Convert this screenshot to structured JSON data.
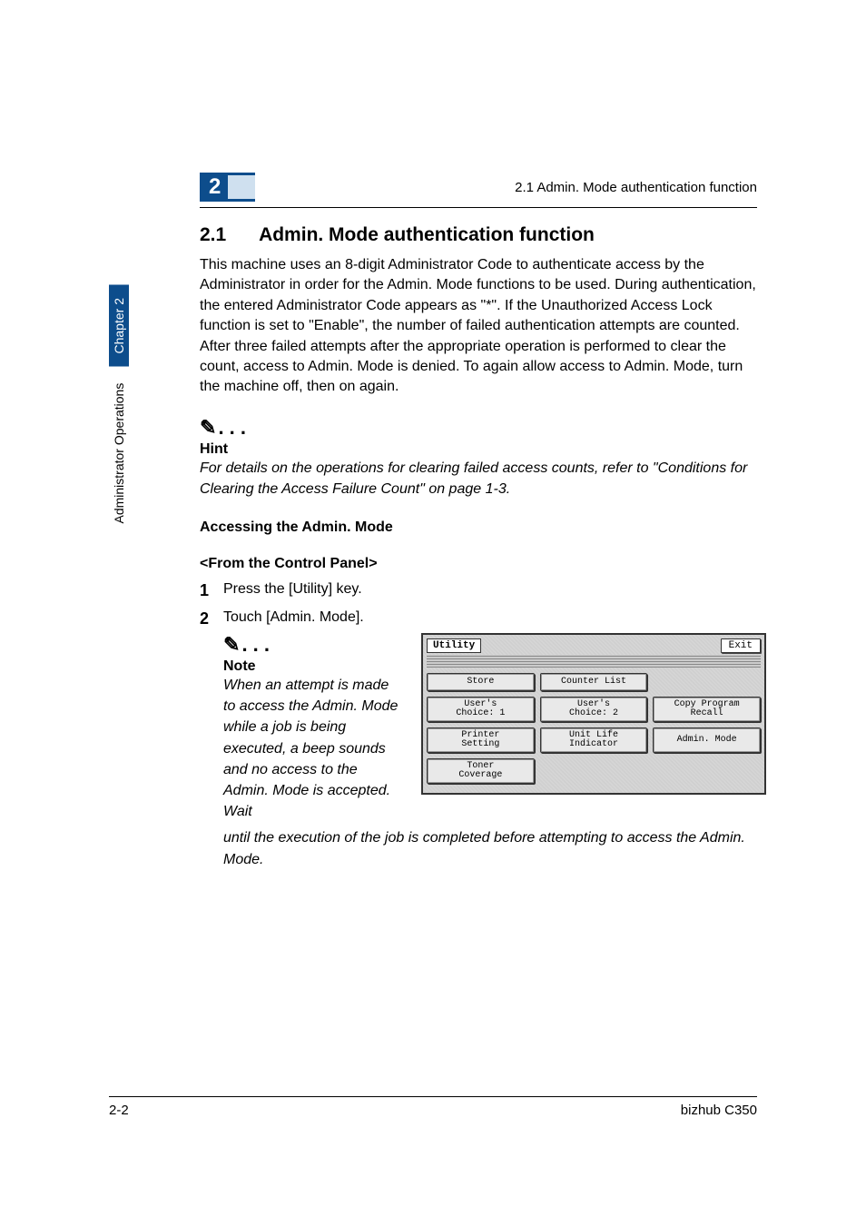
{
  "header": {
    "chapter_number": "2",
    "title": "2.1 Admin. Mode authentication function"
  },
  "side_tab": {
    "chapter_label": "Chapter 2",
    "section_label": "Administrator Operations"
  },
  "section": {
    "number": "2.1",
    "title": "Admin. Mode authentication function",
    "intro": "This machine uses an 8-digit Administrator Code to authenticate access by the Administrator in order for the Admin. Mode functions to be used. During authentication, the entered Administrator Code appears as \"*\". If the Unauthorized Access Lock function is set to \"Enable\", the number of failed authentication attempts are counted. After three failed attempts after the appropriate operation is performed to clear the count, access to Admin. Mode is denied. To again allow access to Admin. Mode, turn the machine off, then on again."
  },
  "hint": {
    "label": "Hint",
    "text": "For details on the operations for clearing failed access counts, refer to \"Conditions for Clearing the Access Failure Count\" on page 1-3."
  },
  "subheads": {
    "accessing": "Accessing the Admin. Mode",
    "panel": "<From the Control Panel>"
  },
  "steps": {
    "s1": {
      "num": "1",
      "text": "Press the [Utility] key."
    },
    "s2": {
      "num": "2",
      "text": "Touch [Admin. Mode]."
    }
  },
  "note": {
    "label": "Note",
    "text": "When an attempt is made to access the Admin. Mode while a job is being executed, a beep sounds and no access to the Admin. Mode is accepted. Wait",
    "continuation": "until the execution of the job is completed before attempting to access the Admin. Mode."
  },
  "lcd": {
    "title": "Utility",
    "exit": "Exit",
    "row1": {
      "a": "Store",
      "b": "Counter List"
    },
    "row2": {
      "a": "User's\nChoice: 1",
      "b": "User's\nChoice: 2",
      "c": "Copy Program\nRecall"
    },
    "row3": {
      "a": "Printer\nSetting",
      "b": "Unit Life\nIndicator",
      "c": "Admin. Mode"
    },
    "row4": {
      "a": "Toner\nCoverage"
    }
  },
  "footer": {
    "page": "2-2",
    "product": "bizhub C350"
  }
}
